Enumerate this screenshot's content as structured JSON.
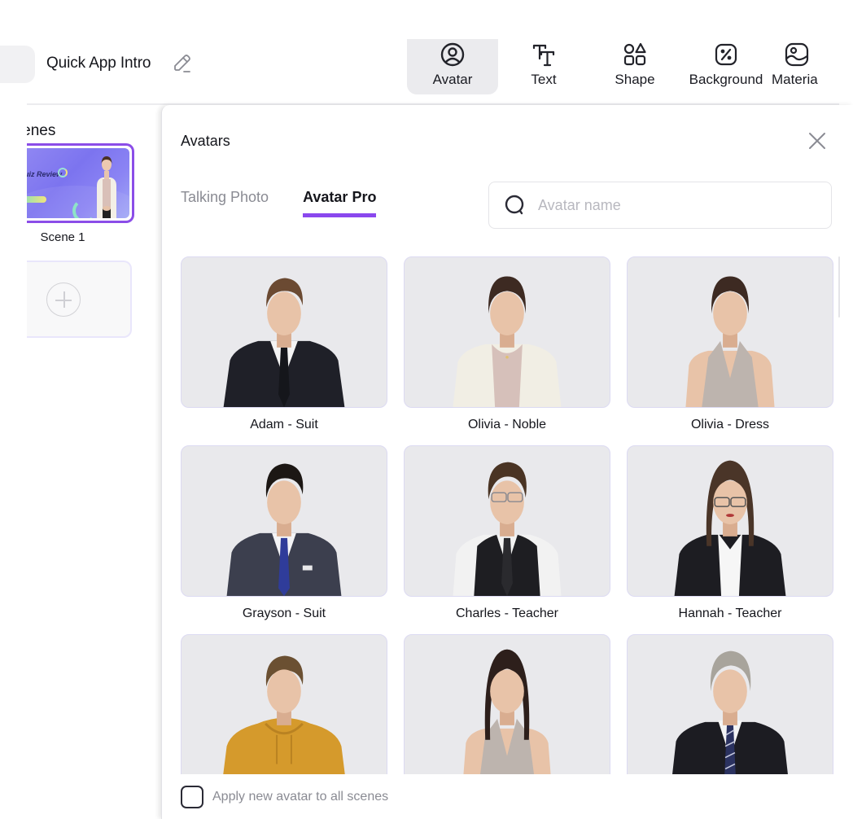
{
  "header": {
    "project_title": "Quick App Intro",
    "edit_icon": "pencil-icon",
    "tools": [
      {
        "label": "Avatar",
        "icon": "avatar-icon",
        "active": true
      },
      {
        "label": "Text",
        "icon": "text-icon",
        "active": false
      },
      {
        "label": "Shape",
        "icon": "shapes-icon",
        "active": false
      },
      {
        "label": "Background",
        "icon": "background-icon",
        "active": false
      },
      {
        "label": "Materia",
        "icon": "image-icon",
        "active": false
      }
    ]
  },
  "scenes": {
    "title": "Scenes",
    "items": [
      {
        "label": "Scene 1",
        "thumbnail_text": "Quiz Review",
        "selected": true
      }
    ],
    "add_icon": "plus-icon"
  },
  "panel": {
    "title": "Avatars",
    "close_icon": "close-icon",
    "tabs": [
      {
        "label": "Talking Photo",
        "active": false
      },
      {
        "label": "Avatar Pro",
        "active": true
      }
    ],
    "search": {
      "placeholder": "Avatar name",
      "value": "",
      "icon": "search-icon"
    },
    "avatars": [
      {
        "name": "Adam - Suit",
        "outfit": "black-suit"
      },
      {
        "name": "Olivia - Noble",
        "outfit": "white-blazer"
      },
      {
        "name": "Olivia - Dress",
        "outfit": "halter-dress"
      },
      {
        "name": "Grayson - Suit",
        "outfit": "grey-suit"
      },
      {
        "name": "Charles - Teacher",
        "outfit": "vest-tie"
      },
      {
        "name": "Hannah - Teacher",
        "outfit": "black-blazer"
      },
      {
        "name": "",
        "outfit": "yellow-hoodie"
      },
      {
        "name": "",
        "outfit": "halter-dress-dark-hair"
      },
      {
        "name": "",
        "outfit": "senior-suit"
      }
    ],
    "apply_all": {
      "label": "Apply new avatar to all scenes",
      "checked": false
    }
  },
  "colors": {
    "accent": "#8a48ee",
    "active_tool_bg": "#ebebee",
    "card_bg": "#e9e9ec"
  }
}
